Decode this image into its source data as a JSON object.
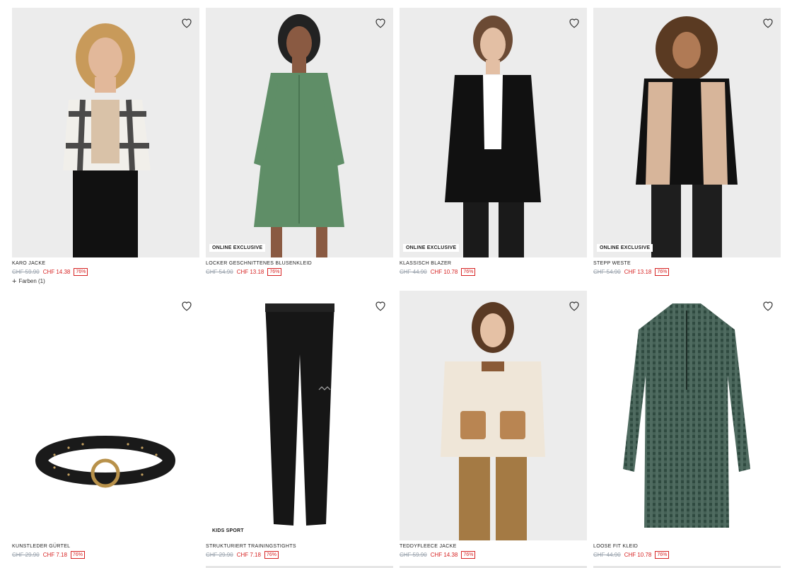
{
  "products": [
    {
      "name": "KARO JACKE",
      "old_price": "CHF 59.90",
      "new_price": "CHF 14.38",
      "discount": "76%",
      "colors": "Farben (1)",
      "badge": ""
    },
    {
      "name": "LOCKER GESCHNITTENES BLUSENKLEID",
      "old_price": "CHF 54.90",
      "new_price": "CHF 13.18",
      "discount": "76%",
      "badge": "ONLINE EXCLUSIVE"
    },
    {
      "name": "KLASSISCH BLAZER",
      "old_price": "CHF 44.90",
      "new_price": "CHF 10.78",
      "discount": "76%",
      "badge": "ONLINE EXCLUSIVE"
    },
    {
      "name": "STEPP WESTE",
      "old_price": "CHF 54.90",
      "new_price": "CHF 13.18",
      "discount": "76%",
      "badge": "ONLINE EXCLUSIVE"
    },
    {
      "name": "KUNSTLEDER GÜRTEL",
      "old_price": "CHF 29.90",
      "new_price": "CHF 7.18",
      "discount": "76%",
      "badge": ""
    },
    {
      "name": "STRUKTURIERT TRAININGSTIGHTS",
      "old_price": "CHF 29.90",
      "new_price": "CHF 7.18",
      "discount": "76%",
      "badge": "KIDS SPORT"
    },
    {
      "name": "TEDDYFLEECE JACKE",
      "old_price": "CHF 59.90",
      "new_price": "CHF 14.38",
      "discount": "76%",
      "badge": ""
    },
    {
      "name": "LOOSE FIT KLEID",
      "old_price": "CHF 44.90",
      "new_price": "CHF 10.78",
      "discount": "76%",
      "badge": ""
    }
  ]
}
